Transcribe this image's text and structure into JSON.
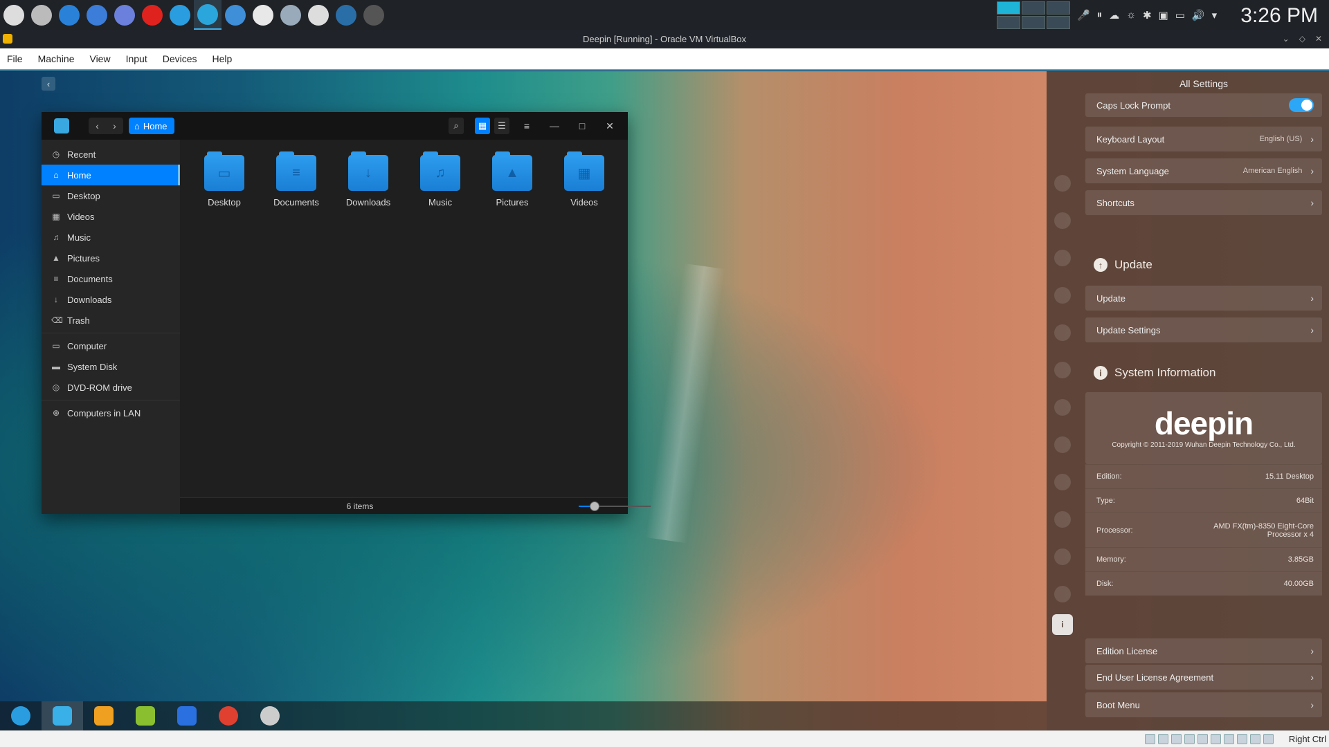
{
  "host": {
    "taskbar_icons": [
      "launcher-icon",
      "settings-sliders-icon",
      "file-manager-icon",
      "thunderbird-icon",
      "chromium-icon",
      "opera-icon",
      "vscode-icon",
      "virtualbox-icon",
      "chat-icon",
      "text-editor-icon",
      "network-icon",
      "obs-icon",
      "steam-icon",
      "terminal-icon"
    ],
    "active_icon_index": 7,
    "clock": "3:26 PM"
  },
  "vbox": {
    "title": "Deepin [Running] - Oracle VM VirtualBox",
    "menu": [
      "File",
      "Machine",
      "View",
      "Input",
      "Devices",
      "Help"
    ],
    "host_key": "Right Ctrl"
  },
  "file_manager": {
    "breadcrumb": "Home",
    "sidebar": [
      {
        "label": "Recent",
        "icon": "clock-icon"
      },
      {
        "label": "Home",
        "icon": "home-icon",
        "selected": true
      },
      {
        "label": "Desktop",
        "icon": "desktop-icon"
      },
      {
        "label": "Videos",
        "icon": "film-icon"
      },
      {
        "label": "Music",
        "icon": "music-icon"
      },
      {
        "label": "Pictures",
        "icon": "image-icon"
      },
      {
        "label": "Documents",
        "icon": "document-icon"
      },
      {
        "label": "Downloads",
        "icon": "download-icon"
      },
      {
        "label": "Trash",
        "icon": "trash-icon"
      },
      {
        "label": "Computer",
        "icon": "computer-icon"
      },
      {
        "label": "System Disk",
        "icon": "disk-icon"
      },
      {
        "label": "DVD-ROM drive",
        "icon": "dvd-icon"
      },
      {
        "label": "Computers in LAN",
        "icon": "network-icon"
      }
    ],
    "folders": [
      {
        "label": "Desktop",
        "glyph": "▭"
      },
      {
        "label": "Documents",
        "glyph": "≡"
      },
      {
        "label": "Downloads",
        "glyph": "↓"
      },
      {
        "label": "Music",
        "glyph": "♫"
      },
      {
        "label": "Pictures",
        "glyph": "▲"
      },
      {
        "label": "Videos",
        "glyph": "▦"
      }
    ],
    "status": "6 items",
    "icon_size_level": 0.22
  },
  "control_center": {
    "title": "All Settings",
    "rows_top": [
      {
        "label": "Caps Lock Prompt",
        "toggle": true
      },
      {
        "label": "Keyboard Layout",
        "value": "English (US)"
      },
      {
        "label": "System Language",
        "value": "American English"
      },
      {
        "label": "Shortcuts",
        "value": ""
      }
    ],
    "update_section": {
      "title": "Update",
      "rows": [
        "Update",
        "Update Settings"
      ]
    },
    "sysinfo_section": {
      "title": "System Information",
      "logo": "deepin",
      "copyright": "Copyright © 2011-2019 Wuhan Deepin Technology Co., Ltd.",
      "details": [
        {
          "label": "Edition:",
          "value": "15.11 Desktop"
        },
        {
          "label": "Type:",
          "value": "64Bit"
        },
        {
          "label": "Processor:",
          "value": "AMD FX(tm)-8350 Eight-Core Processor x 4"
        },
        {
          "label": "Memory:",
          "value": "3.85GB"
        },
        {
          "label": "Disk:",
          "value": "40.00GB"
        }
      ],
      "links": [
        "Edition License",
        "End User License Agreement",
        "Boot Menu"
      ]
    }
  },
  "guest_dock": [
    "deepin-launcher-icon",
    "file-manager-icon",
    "app-store-icon",
    "music-player-icon",
    "movie-player-icon",
    "chrome-icon",
    "settings-icon"
  ]
}
